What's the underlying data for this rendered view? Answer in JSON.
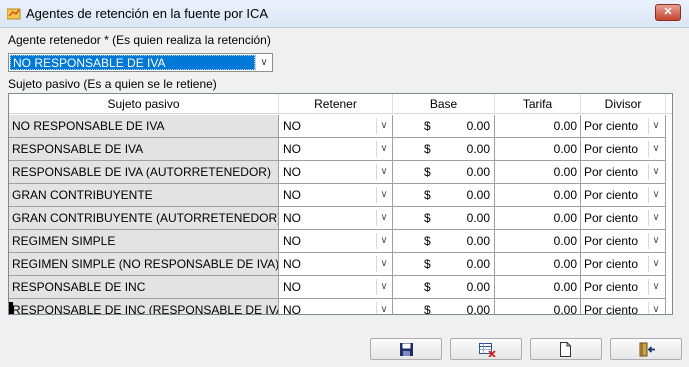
{
  "window": {
    "title": "Agentes de retención en la fuente por ICA",
    "close_label": "✕"
  },
  "agente": {
    "label": "Agente retenedor * (Es quien realiza la retención)",
    "value": "NO RESPONSABLE DE IVA"
  },
  "sujeto_label": "Sujeto pasivo (Es a quien se le retiene)",
  "grid": {
    "columns": [
      "Sujeto pasivo",
      "Retener",
      "Base",
      "Tarifa",
      "Divisor"
    ],
    "currency": "$",
    "rows": [
      {
        "name": "NO RESPONSABLE DE IVA",
        "retener": "NO",
        "base": "0.00",
        "tarifa": "0.00",
        "divisor": "Por ciento"
      },
      {
        "name": "RESPONSABLE DE IVA",
        "retener": "NO",
        "base": "0.00",
        "tarifa": "0.00",
        "divisor": "Por ciento"
      },
      {
        "name": "RESPONSABLE DE IVA (AUTORRETENEDOR)",
        "retener": "NO",
        "base": "0.00",
        "tarifa": "0.00",
        "divisor": "Por ciento"
      },
      {
        "name": "GRAN CONTRIBUYENTE",
        "retener": "NO",
        "base": "0.00",
        "tarifa": "0.00",
        "divisor": "Por ciento"
      },
      {
        "name": "GRAN CONTRIBUYENTE (AUTORRETENEDOR)",
        "retener": "NO",
        "base": "0.00",
        "tarifa": "0.00",
        "divisor": "Por ciento"
      },
      {
        "name": "REGIMEN SIMPLE",
        "retener": "NO",
        "base": "0.00",
        "tarifa": "0.00",
        "divisor": "Por ciento"
      },
      {
        "name": "REGIMEN SIMPLE (NO RESPONSABLE DE IVA)",
        "retener": "NO",
        "base": "0.00",
        "tarifa": "0.00",
        "divisor": "Por ciento"
      },
      {
        "name": "RESPONSABLE DE INC",
        "retener": "NO",
        "base": "0.00",
        "tarifa": "0.00",
        "divisor": "Por ciento"
      },
      {
        "name": "RESPONSABLE DE INC (RESPONSABLE DE IVA)",
        "retener": "NO",
        "base": "0.00",
        "tarifa": "0.00",
        "divisor": "Por ciento"
      }
    ]
  },
  "toolbar": {
    "buttons": [
      {
        "icon": "save-icon"
      },
      {
        "icon": "delete-grid-icon"
      },
      {
        "icon": "new-document-icon"
      },
      {
        "icon": "exit-icon"
      }
    ]
  }
}
